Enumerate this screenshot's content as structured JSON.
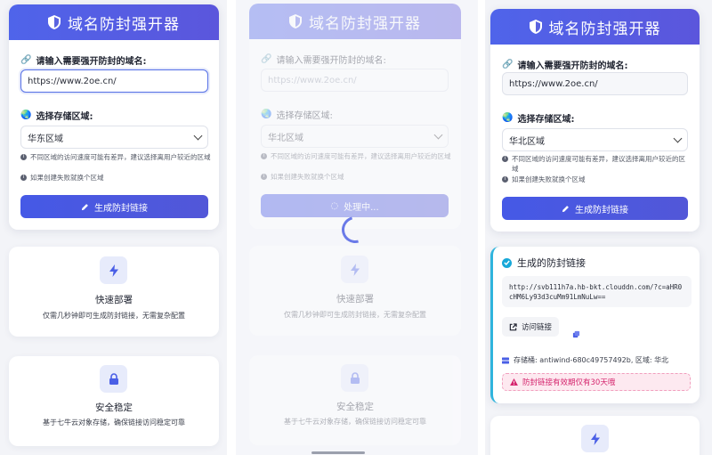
{
  "app": {
    "title": "域名防封强开器",
    "input_label": "请输入需要强开防封的域名:",
    "region_label": "选择存储区域:",
    "hint1": "不同区域的访问速度可能有差异，建议选择离用户较近的区域",
    "hint2": "如果创建失败就换个区域",
    "generate_label": "生成防封链接",
    "processing_label": "处理中..."
  },
  "panels": {
    "first": {
      "domain_value": "https://www.2oe.cn/",
      "region_value": "华东区域"
    },
    "second": {
      "domain_placeholder": "https://www.2oe.cn/",
      "region_value": "华北区域"
    },
    "third": {
      "domain_value": "https://www.2oe.cn/",
      "region_value": "华北区域"
    }
  },
  "features": [
    {
      "title": "快速部署",
      "desc": "仅需几秒钟即可生成防封链接，无需复杂配置",
      "icon": "lightning-icon"
    },
    {
      "title": "安全稳定",
      "desc": "基于七牛云对象存储，确保链接访问稳定可靠",
      "icon": "lock-icon"
    }
  ],
  "result": {
    "title": "生成的防封链接",
    "link": "http://svb111h7a.hb-bkt.clouddn.com/?c=aHR0cHM6Ly93d3cuMm91LmNuLw==",
    "visit_label": "访问链接",
    "bucket_info": "存储桶: antiwind-680c49757492b, 区域: 华北",
    "warning": "防封链接有效期仅有30天哦"
  },
  "colors": {
    "accent": "#4f64ea",
    "result_border": "#2fb4dd",
    "warning_text": "#d5266e"
  }
}
